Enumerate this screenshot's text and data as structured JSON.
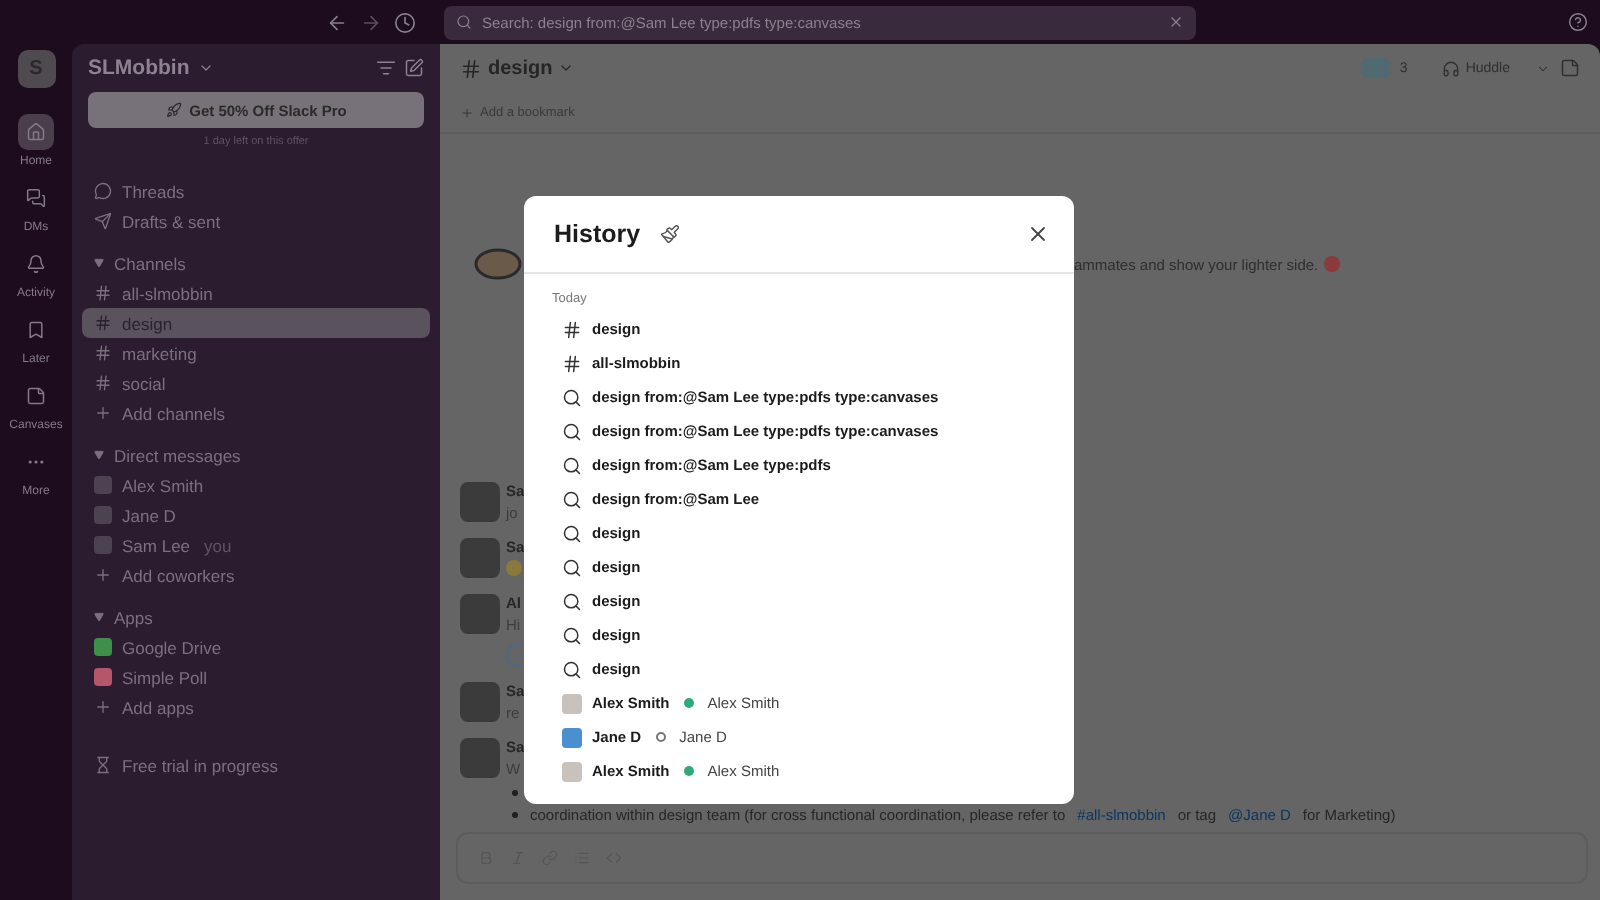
{
  "topbar": {
    "search": "Search: design from:@Sam Lee type:pdfs type:canvases"
  },
  "workspace": {
    "initial": "S",
    "name": "SLMobbin"
  },
  "rail": [
    {
      "kind": "home",
      "label": "Home",
      "selected": true
    },
    {
      "kind": "dms",
      "label": "DMs",
      "selected": false
    },
    {
      "kind": "activity",
      "label": "Activity",
      "selected": false
    },
    {
      "kind": "later",
      "label": "Later",
      "selected": false
    },
    {
      "kind": "canvases",
      "label": "Canvases",
      "selected": false
    },
    {
      "kind": "more",
      "label": "More",
      "selected": false
    }
  ],
  "promo": {
    "button": "Get 50% Off Slack Pro",
    "note": "1 day left on this offer"
  },
  "nav": [
    {
      "kind": "threads",
      "label": "Threads"
    },
    {
      "kind": "drafts",
      "label": "Drafts & sent"
    }
  ],
  "sections": [
    {
      "title": "Channels",
      "expanded": true,
      "items": [
        {
          "kind": "channel",
          "label": "all-slmobbin",
          "selected": false
        },
        {
          "kind": "channel",
          "label": "design",
          "selected": true
        },
        {
          "kind": "channel",
          "label": "marketing",
          "selected": false
        },
        {
          "kind": "channel",
          "label": "social",
          "selected": false
        },
        {
          "kind": "add",
          "label": "Add channels",
          "selected": false
        }
      ]
    },
    {
      "title": "Direct messages",
      "expanded": true,
      "items": [
        {
          "kind": "dm",
          "label": "Alex Smith",
          "selected": false
        },
        {
          "kind": "dm",
          "label": "Jane D",
          "selected": false
        },
        {
          "kind": "dm",
          "label": "Sam Lee",
          "suffix": "you",
          "selected": false
        },
        {
          "kind": "add",
          "label": "Add coworkers",
          "selected": false
        }
      ]
    },
    {
      "title": "Apps",
      "expanded": true,
      "items": [
        {
          "kind": "app",
          "label": "Google Drive",
          "color": "#3f8f4a",
          "selected": false
        },
        {
          "kind": "app",
          "label": "Simple Poll",
          "color": "#b4576a",
          "selected": false
        },
        {
          "kind": "add",
          "label": "Add apps",
          "selected": false
        }
      ]
    }
  ],
  "trial": "Free trial in progress",
  "channel": {
    "name": "design",
    "members": "3",
    "huddle": "Huddle",
    "bookmark": "Add a bookmark"
  },
  "hero": {
    "text": "ammates and show your lighter side."
  },
  "messages": [
    {
      "name": "Sa",
      "text": "jo",
      "emoji": false,
      "reaction": false
    },
    {
      "name": "Sa",
      "emoji": true,
      "reaction": false
    },
    {
      "name": "Al",
      "text": "Hi",
      "emoji": false,
      "reaction": true
    },
    {
      "name": "Sa",
      "text": "re",
      "emoji": false,
      "reaction": false
    },
    {
      "name": "Sa",
      "text": "W",
      "emoji": false,
      "reaction": false
    }
  ],
  "bullets": [
    {
      "kind": "covered"
    },
    {
      "kind": "text",
      "parts": [
        {
          "kind": "text",
          "text": "coordination within design team (for cross functional coordination, please refer to"
        },
        {
          "kind": "link",
          "text": "#all-slmobbin"
        },
        {
          "kind": "text",
          "text": "or tag"
        },
        {
          "kind": "link",
          "text": "@Jane D"
        },
        {
          "kind": "text",
          "text": "for Marketing)"
        }
      ]
    }
  ],
  "history": {
    "title": "History",
    "group": "Today",
    "items": [
      {
        "kind": "channel",
        "label": "design"
      },
      {
        "kind": "channel",
        "label": "all-slmobbin"
      },
      {
        "kind": "search",
        "label": "design from:@Sam Lee type:pdfs type:canvases"
      },
      {
        "kind": "search",
        "label": "design from:@Sam Lee type:pdfs type:canvases"
      },
      {
        "kind": "search",
        "label": "design from:@Sam Lee type:pdfs"
      },
      {
        "kind": "search",
        "label": "design from:@Sam Lee"
      },
      {
        "kind": "search",
        "label": "design"
      },
      {
        "kind": "search",
        "label": "design"
      },
      {
        "kind": "search",
        "label": "design"
      },
      {
        "kind": "search",
        "label": "design"
      },
      {
        "kind": "search",
        "label": "design"
      },
      {
        "kind": "person",
        "label": "Alex Smith",
        "has_photo": true,
        "online": true,
        "secondary": "Alex Smith"
      },
      {
        "kind": "person",
        "label": "Jane D",
        "has_photo": false,
        "online": false,
        "secondary": "Jane D"
      },
      {
        "kind": "person",
        "label": "Alex Smith",
        "has_photo": true,
        "online": true,
        "secondary": "Alex Smith"
      }
    ]
  }
}
